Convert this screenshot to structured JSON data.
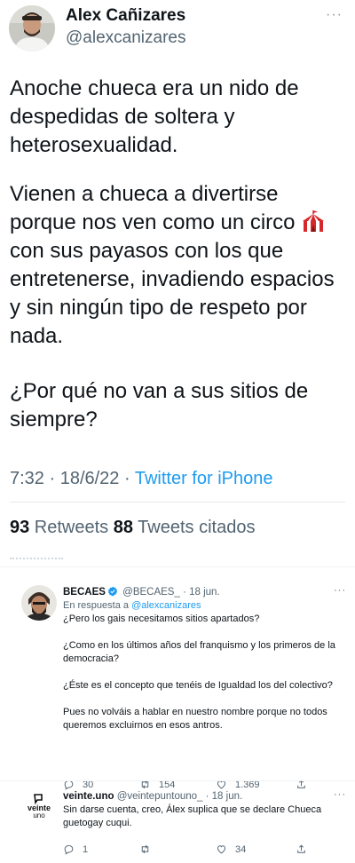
{
  "tweet": {
    "author": {
      "display_name": "Alex Cañizares",
      "handle": "@alexcanizares",
      "more_label": "···"
    },
    "paragraphs": {
      "p1": "Anoche chueca era un nido de despedidas de soltera y heterosexualidad.",
      "p2_before_emoji": "Vienen a chueca a divertirse porque nos ven como un circo ",
      "p2_emoji": "circus-tent-icon",
      "p2_after_emoji": "con sus payasos con los que entretenerse, invadiendo espacios y sin ningún tipo de respeto por nada.",
      "p3": "¿Por qué no van a sus sitios de siempre?"
    },
    "meta": {
      "time_date": "7:32 · 18/6/22 · ",
      "source": "Twitter for iPhone"
    },
    "stats": {
      "retweets_count": "93",
      "retweets_label": " Retweets ",
      "quotes_count": "88",
      "quotes_label": " Tweets citados"
    }
  },
  "replies": [
    {
      "display_name": "BECAES",
      "handle_time": "@BECAES_ · 18 jun.",
      "in_reply_prefix": "En respuesta a ",
      "in_reply_handle": "@alexcanizares",
      "paragraphs": [
        "¿Pero los gais necesitamos sitios apartados?",
        "¿Como en los últimos años del franquismo y los primeros de la democracia?",
        "¿Éste es el concepto que tenéis de Igualdad los del colectivo?",
        "Pues no volváis a hablar en nuestro nombre porque no todos queremos excluirnos en esos antros."
      ],
      "actions": {
        "replies": "30",
        "retweets": "154",
        "likes": "1.369"
      }
    },
    {
      "display_name": "veinte.uno",
      "handle_time": "@veintepuntouno_ · 18 jun.",
      "avatar_logo_text_1": "veinte",
      "avatar_logo_text_2": "uno",
      "text": "Sin darse cuenta, creo, Álex suplica que se declare Chueca guetogay cuqui.",
      "actions": {
        "replies": "1",
        "retweets": "",
        "likes": "34"
      }
    }
  ],
  "colors": {
    "link": "#1d9bf0",
    "secondary_text": "#536471",
    "primary_text": "#0f1419"
  }
}
